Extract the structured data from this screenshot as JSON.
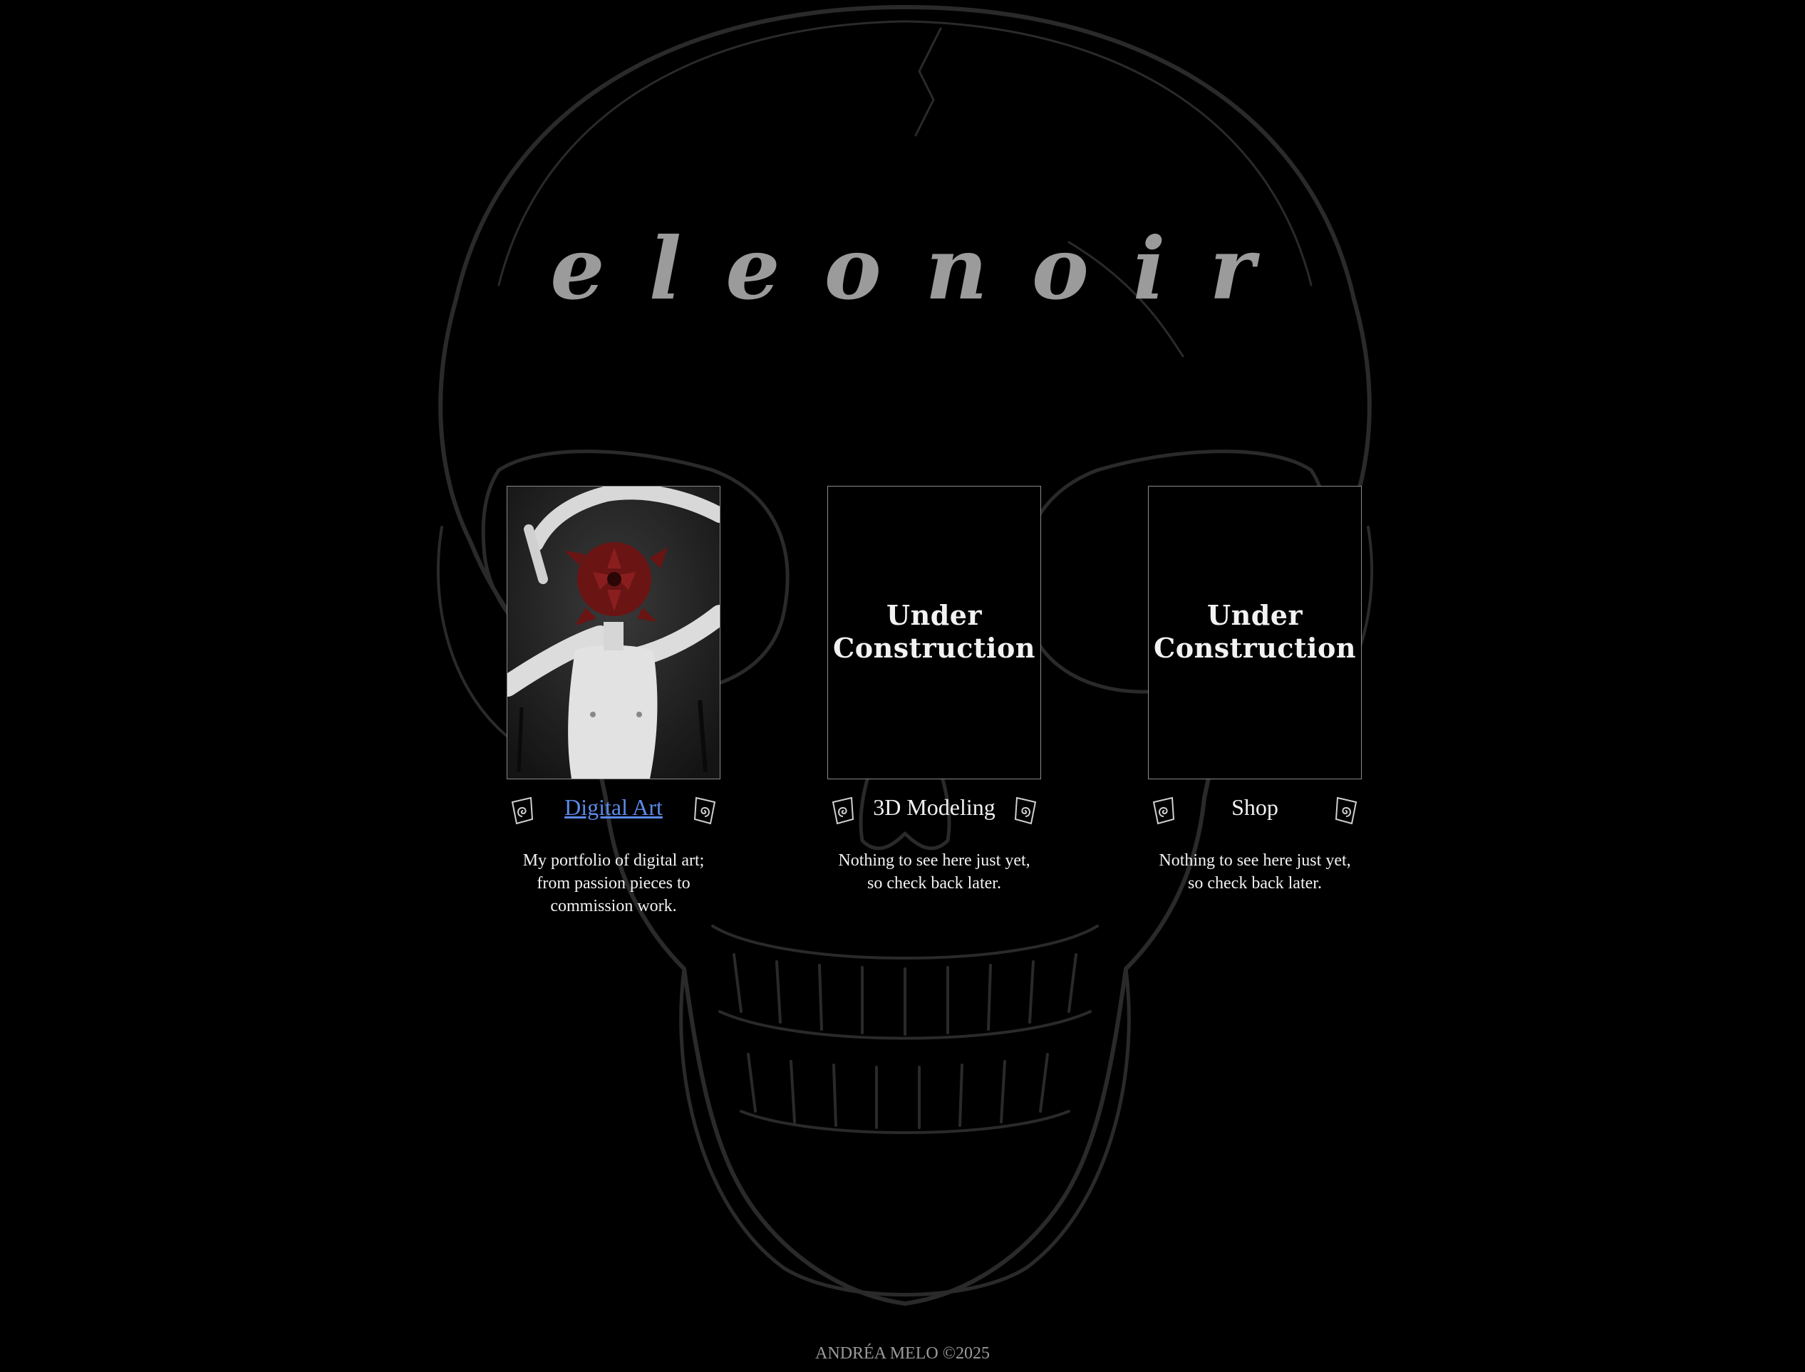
{
  "site": {
    "title": "eleonoir"
  },
  "cards": [
    {
      "label": "Digital Art",
      "description": "My portfolio of digital art; from passion pieces to commission work."
    },
    {
      "label": "3D Modeling",
      "placeholder": "Under Construction",
      "description": "Nothing to see here just yet, so check back later."
    },
    {
      "label": "Shop",
      "placeholder": "Under Construction",
      "description": "Nothing to see here just yet, so check back later."
    }
  ],
  "footer": {
    "text": "ANDRÉA MELO ©2025"
  },
  "colors": {
    "background": "#000000",
    "title": "#9b9b9b",
    "link": "#5b8ae8",
    "skull_line": "#2a2a2a"
  },
  "icons": {
    "background": "skull-outline-icon",
    "label_ornament": "spiral-ornament-icon"
  }
}
